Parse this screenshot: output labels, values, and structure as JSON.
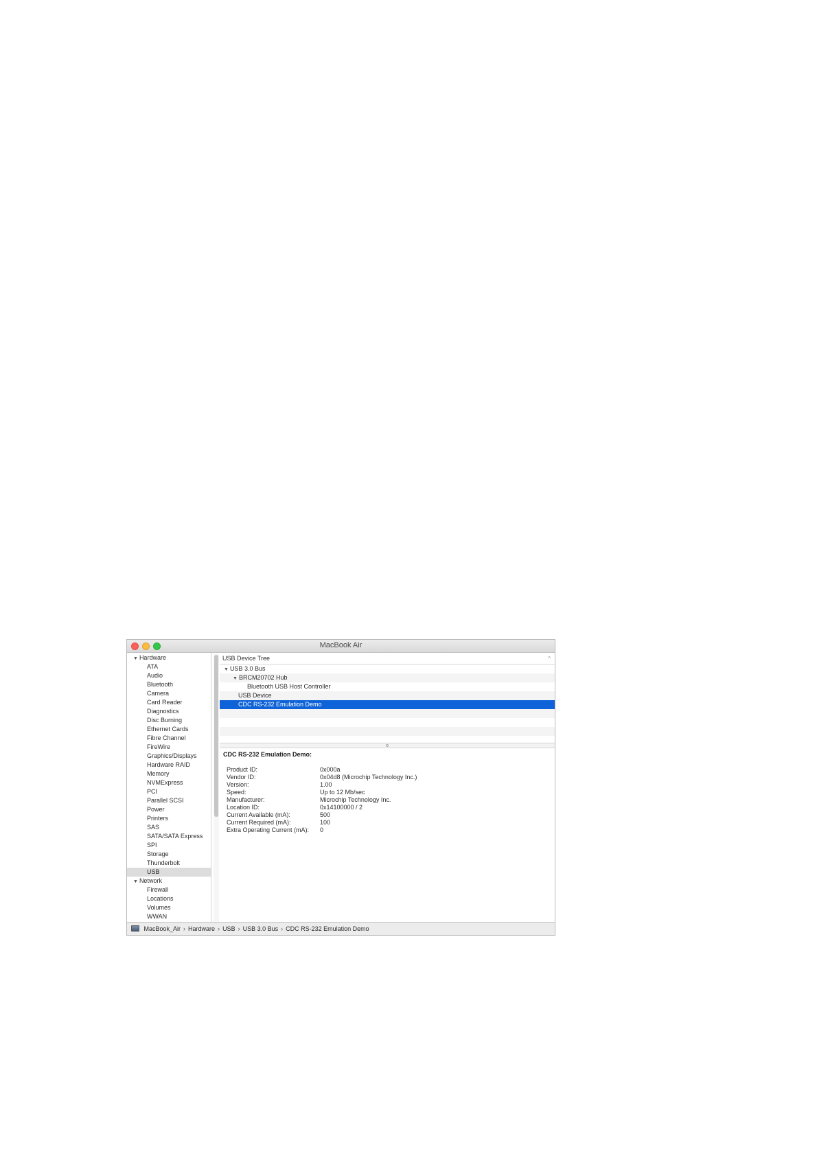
{
  "window": {
    "title": "MacBook Air"
  },
  "sidebar": {
    "items": [
      {
        "label": "Hardware",
        "type": "category"
      },
      {
        "label": "ATA",
        "type": "sub"
      },
      {
        "label": "Audio",
        "type": "sub"
      },
      {
        "label": "Bluetooth",
        "type": "sub"
      },
      {
        "label": "Camera",
        "type": "sub"
      },
      {
        "label": "Card Reader",
        "type": "sub"
      },
      {
        "label": "Diagnostics",
        "type": "sub"
      },
      {
        "label": "Disc Burning",
        "type": "sub"
      },
      {
        "label": "Ethernet Cards",
        "type": "sub"
      },
      {
        "label": "Fibre Channel",
        "type": "sub"
      },
      {
        "label": "FireWire",
        "type": "sub"
      },
      {
        "label": "Graphics/Displays",
        "type": "sub"
      },
      {
        "label": "Hardware RAID",
        "type": "sub"
      },
      {
        "label": "Memory",
        "type": "sub"
      },
      {
        "label": "NVMExpress",
        "type": "sub"
      },
      {
        "label": "PCI",
        "type": "sub"
      },
      {
        "label": "Parallel SCSI",
        "type": "sub"
      },
      {
        "label": "Power",
        "type": "sub"
      },
      {
        "label": "Printers",
        "type": "sub"
      },
      {
        "label": "SAS",
        "type": "sub"
      },
      {
        "label": "SATA/SATA Express",
        "type": "sub"
      },
      {
        "label": "SPI",
        "type": "sub"
      },
      {
        "label": "Storage",
        "type": "sub"
      },
      {
        "label": "Thunderbolt",
        "type": "sub"
      },
      {
        "label": "USB",
        "type": "sub",
        "selected": true
      },
      {
        "label": "Network",
        "type": "category"
      },
      {
        "label": "Firewall",
        "type": "sub"
      },
      {
        "label": "Locations",
        "type": "sub"
      },
      {
        "label": "Volumes",
        "type": "sub"
      },
      {
        "label": "WWAN",
        "type": "sub"
      }
    ]
  },
  "tree": {
    "header": "USB Device Tree",
    "rows": [
      {
        "label": "USB 3.0 Bus",
        "level": 0,
        "expanded": true
      },
      {
        "label": "BRCM20702 Hub",
        "level": 1,
        "expanded": true
      },
      {
        "label": "Bluetooth USB Host Controller",
        "level": 2
      },
      {
        "label": "USB Device",
        "level": 1
      },
      {
        "label": "CDC RS-232 Emulation Demo",
        "level": 1,
        "selected": true
      }
    ]
  },
  "detail": {
    "title": "CDC RS-232 Emulation Demo:",
    "properties": [
      {
        "label": "Product ID:",
        "value": "0x000a"
      },
      {
        "label": "Vendor ID:",
        "value": "0x04d8  (Microchip Technology Inc.)"
      },
      {
        "label": "Version:",
        "value": "1.00"
      },
      {
        "label": "Speed:",
        "value": "Up to 12 Mb/sec"
      },
      {
        "label": "Manufacturer:",
        "value": "Microchip Technology Inc."
      },
      {
        "label": "Location ID:",
        "value": "0x14100000 / 2"
      },
      {
        "label": "Current Available (mA):",
        "value": "500"
      },
      {
        "label": "Current Required (mA):",
        "value": "100"
      },
      {
        "label": "Extra Operating Current (mA):",
        "value": "0"
      }
    ]
  },
  "pathbar": {
    "crumbs": [
      "MacBook_Air",
      "Hardware",
      "USB",
      "USB 3.0 Bus",
      "CDC RS-232 Emulation Demo"
    ]
  },
  "colors": {
    "selection": "#0f63d8",
    "sidebar_selection": "#dcdcdc",
    "close": "#fc605c",
    "minimize": "#fdbc40",
    "zoom": "#34c84a"
  }
}
